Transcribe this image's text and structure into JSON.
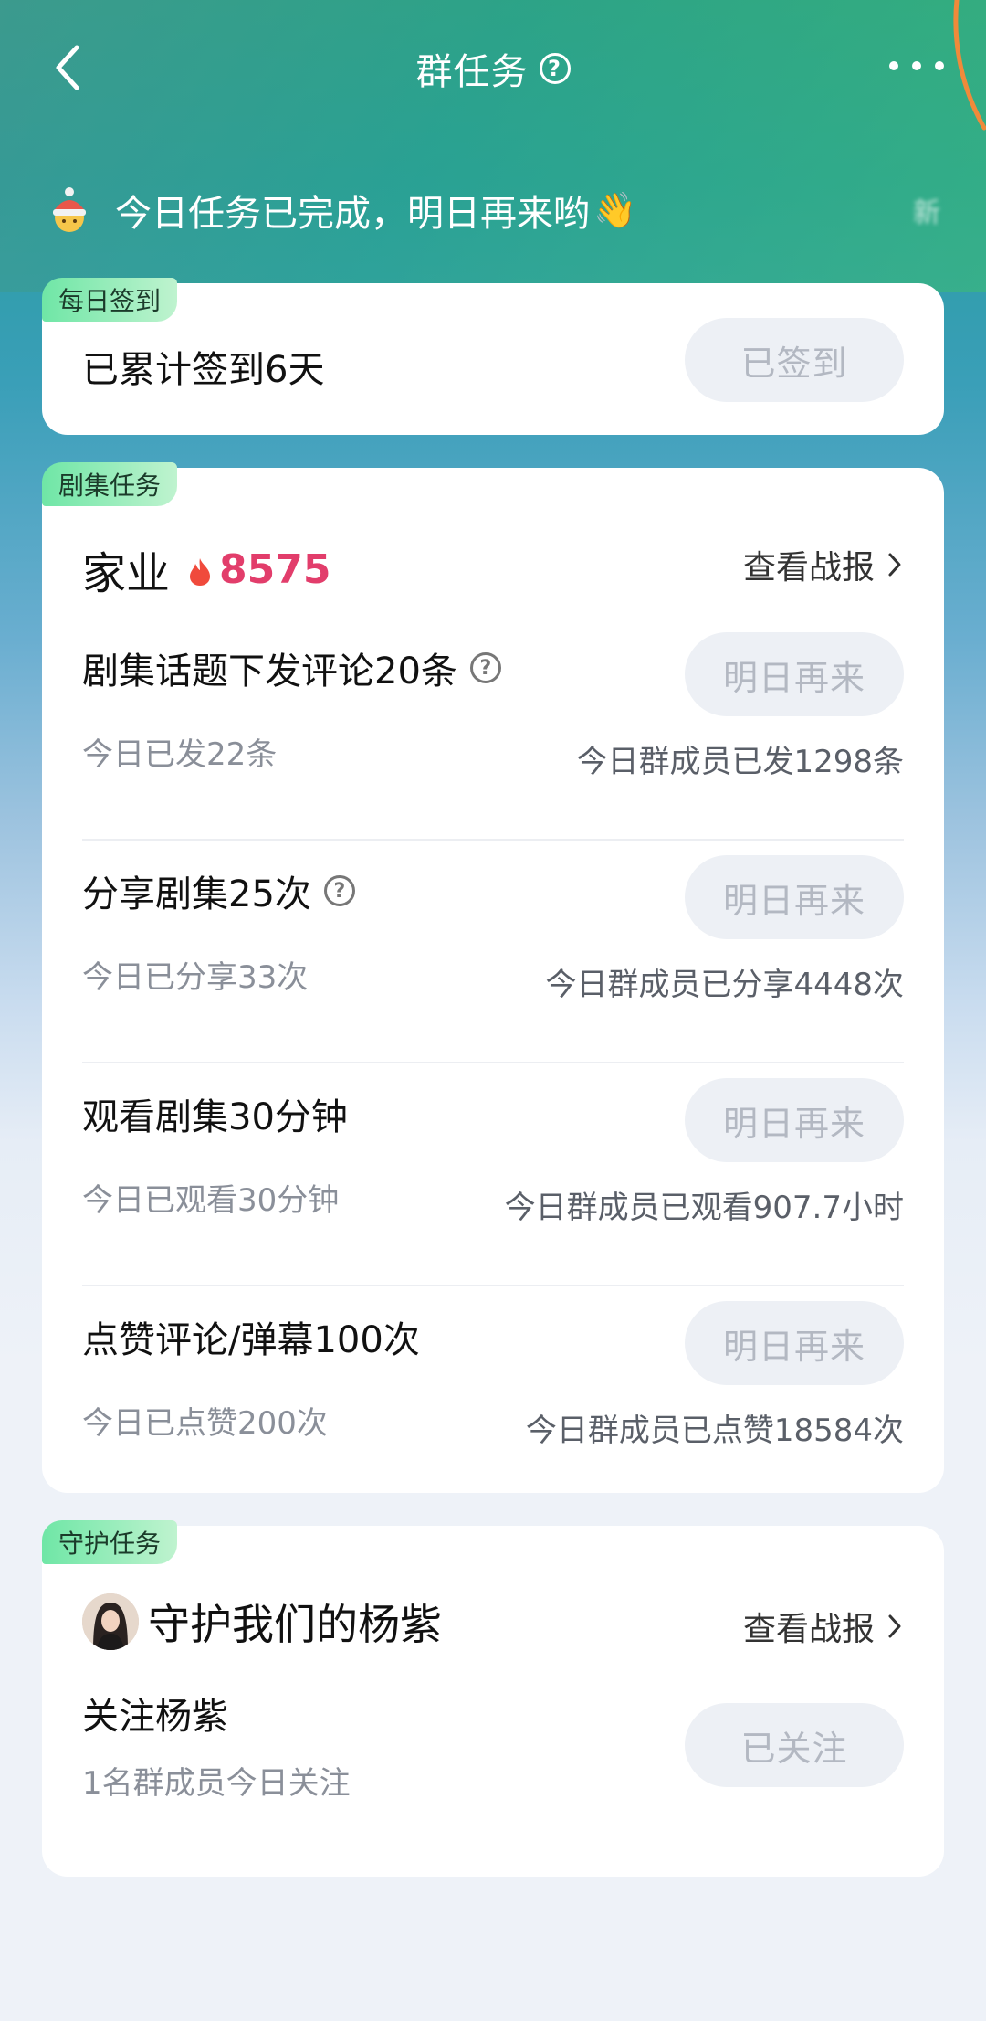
{
  "header": {
    "title": "群任务",
    "help_icon": "?",
    "back_icon": "chevron-left-icon",
    "more_icon": "more-dots-icon"
  },
  "notice": {
    "text": "今日任务已完成，明日再来哟",
    "emoji": "👋",
    "trailing": "新"
  },
  "daily": {
    "tag": "每日签到",
    "text": "已累计签到6天",
    "button": "已签到"
  },
  "series": {
    "tag": "剧集任务",
    "show_name": "家业",
    "heat": "8575",
    "report_link": "查看战报",
    "tasks": [
      {
        "title": "剧集话题下发评论20条",
        "left": "今日已发22条",
        "right": "今日群成员已发1298条",
        "button": "明日再来"
      },
      {
        "title": "分享剧集25次",
        "left": "今日已分享33次",
        "right": "今日群成员已分享4448次",
        "button": "明日再来"
      },
      {
        "title": "观看剧集30分钟",
        "left": "今日已观看30分钟",
        "right": "今日群成员已观看907.7小时",
        "button": "明日再来"
      },
      {
        "title": "点赞评论/弹幕100次",
        "left": "今日已点赞200次",
        "right": "今日群成员已点赞18584次",
        "button": "明日再来"
      }
    ]
  },
  "guard": {
    "tag": "守护任务",
    "name": "守护我们的杨紫",
    "report_link": "查看战报",
    "follow_title": "关注杨紫",
    "follow_sub": "1名群成员今日关注",
    "button": "已关注"
  },
  "colors": {
    "accent_heat": "#e23d6b",
    "tag_green": "#6fe6a6",
    "pill_bg": "#edf0f5"
  }
}
